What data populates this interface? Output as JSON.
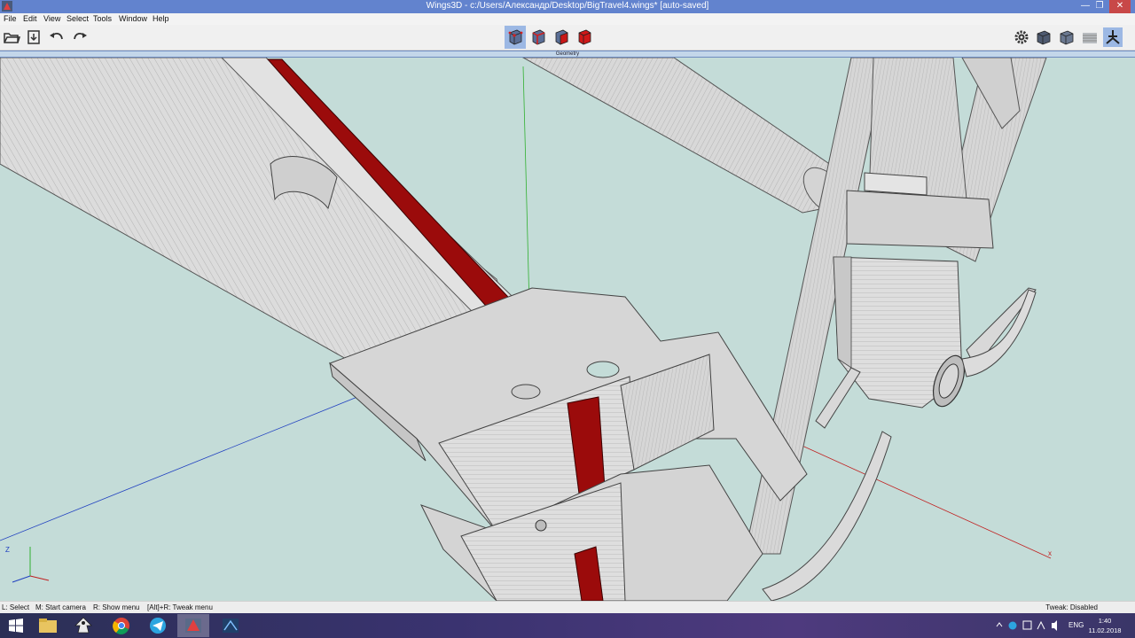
{
  "window": {
    "title": "Wings3D - c:/Users/Александр/Desktop/BigTravel4.wings* [auto-saved]",
    "controls": [
      "minimize",
      "restore",
      "close"
    ]
  },
  "menubar": {
    "items": [
      "File",
      "Edit",
      "View",
      "Select",
      "Tools",
      "Window",
      "Help"
    ]
  },
  "toolbar": {
    "left_icons": [
      "open-folder-icon",
      "save-icon",
      "undo-icon",
      "redo-icon"
    ],
    "selection_modes": [
      "vertex-mode",
      "edge-mode",
      "face-mode",
      "body-mode"
    ],
    "active_selection_mode": "vertex-mode",
    "right_icons": [
      "settings-icon",
      "smooth-shaded-icon",
      "flat-shaded-icon",
      "wireframe-icon",
      "perspective-icon"
    ]
  },
  "geometry_panel": {
    "label": "Geometry"
  },
  "viewport": {
    "background_color": "#c4dcd8",
    "selection_color": "#9b0b0b",
    "mesh_color": "#dadada",
    "axes": {
      "x_label": "x",
      "z_label": "Z",
      "x_color": "#c02020",
      "y_color": "#30b030",
      "z_color": "#2040c0"
    }
  },
  "statusbar": {
    "hints": [
      "L: Select",
      "M: Start camera",
      "R: Show menu",
      "[Alt]+R: Tweak menu"
    ],
    "tweak_status": "Tweak: Disabled"
  },
  "taskbar": {
    "apps": [
      "windows-start-icon",
      "file-explorer-icon",
      "inkscape-icon",
      "chrome-icon",
      "telegram-icon",
      "wings3d-icon",
      "blender-icon"
    ],
    "active_app": "wings3d-icon",
    "tray_language": "ENG",
    "clock_time": "1:40",
    "clock_date": "11.02.2018"
  }
}
